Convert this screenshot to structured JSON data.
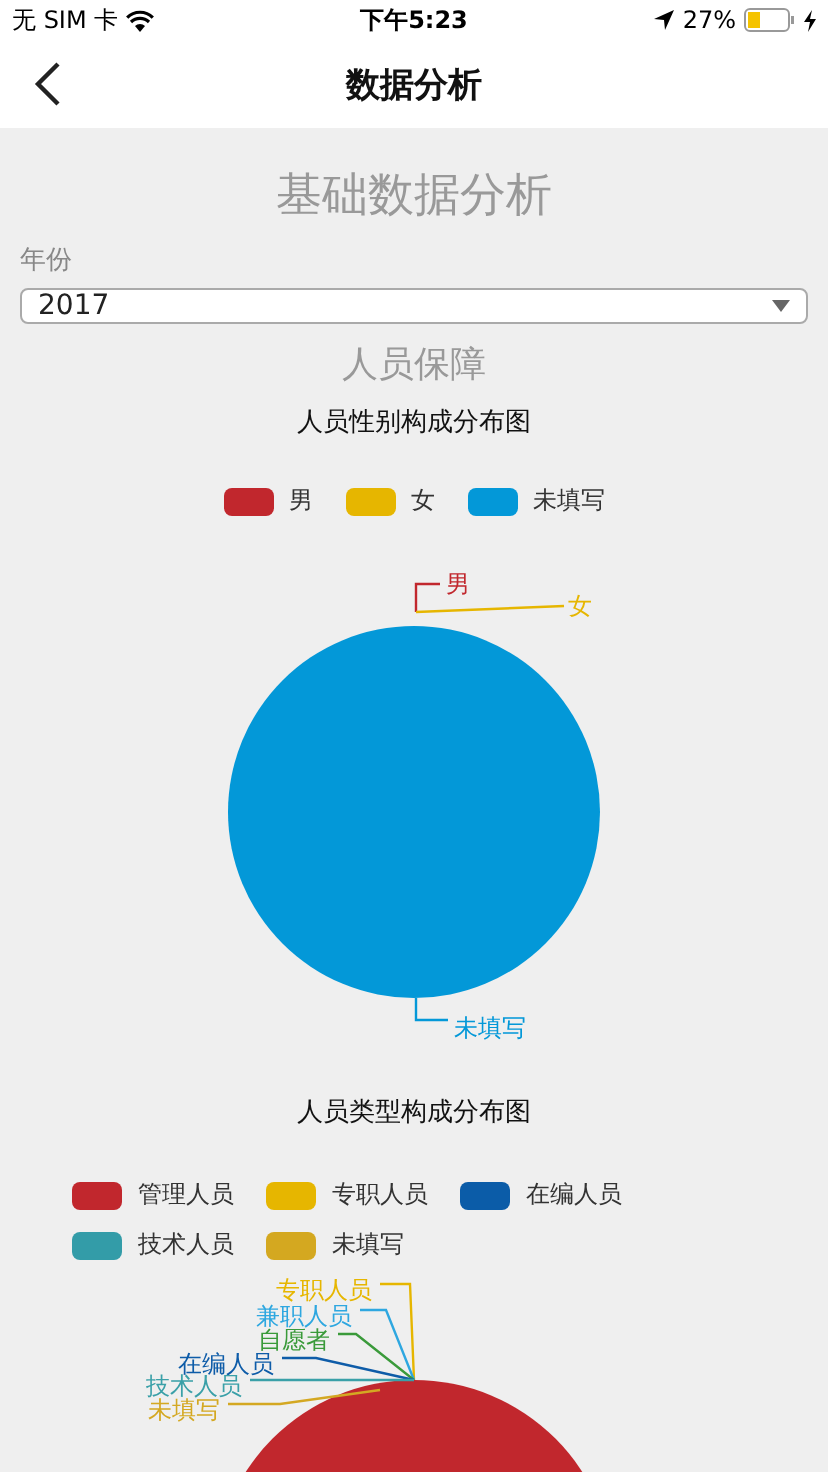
{
  "status_bar": {
    "carrier": "无 SIM 卡",
    "time": "下午5:23",
    "battery": "27%"
  },
  "nav": {
    "title": "数据分析"
  },
  "page_title": "基础数据分析",
  "year_field": {
    "label": "年份",
    "value": "2017"
  },
  "section_title": "人员保障",
  "charts": [
    {
      "title": "人员性别构成分布图",
      "pie": {
        "color": "#0398d8"
      },
      "legend": [
        {
          "label": "男",
          "color": "#c1272d"
        },
        {
          "label": "女",
          "color": "#e6b600"
        },
        {
          "label": "未填写",
          "color": "#0398d8"
        }
      ],
      "callouts": [
        {
          "label": "男",
          "color": "#c1272d"
        },
        {
          "label": "女",
          "color": "#e6b600"
        },
        {
          "label": "未填写",
          "color": "#0398d8"
        }
      ]
    },
    {
      "title": "人员类型构成分布图",
      "pie": {
        "color": "#c1272d"
      },
      "legend": [
        {
          "label": "管理人员",
          "color": "#c1272d"
        },
        {
          "label": "专职人员",
          "color": "#e6b600"
        },
        {
          "label": "在编人员",
          "color": "#0b5ca8"
        },
        {
          "label": "技术人员",
          "color": "#339ca8"
        },
        {
          "label": "未填写",
          "color": "#d4a820"
        }
      ],
      "callouts": [
        {
          "label": "专职人员",
          "color": "#e6b600"
        },
        {
          "label": "兼职人员",
          "color": "#2ea7e0"
        },
        {
          "label": "自愿者",
          "color": "#3a9a3a"
        },
        {
          "label": "在编人员",
          "color": "#0e5ca8"
        },
        {
          "label": "技术人员",
          "color": "#3aa0a8"
        },
        {
          "label": "未填写",
          "color": "#d4a822"
        }
      ]
    }
  ]
}
